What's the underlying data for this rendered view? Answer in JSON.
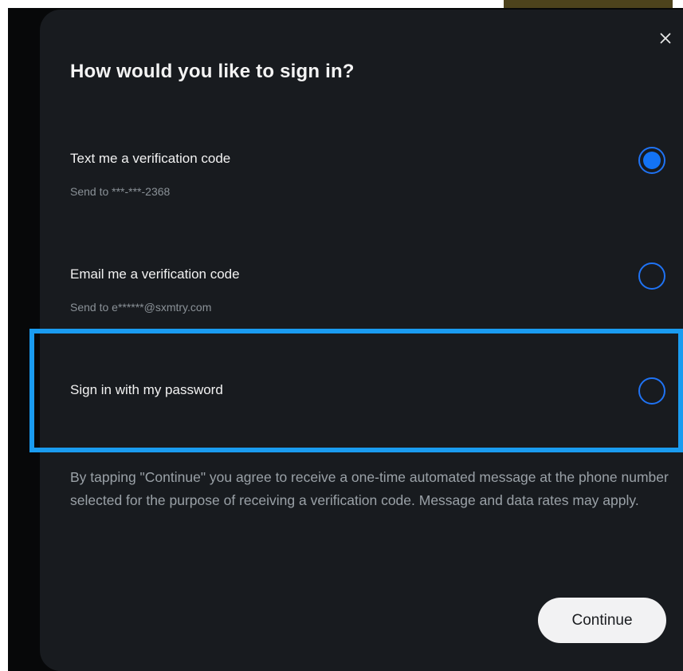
{
  "dialog": {
    "title": "How would you like to sign in?",
    "close_icon": "close-icon"
  },
  "options": [
    {
      "label": "Text me a verification code",
      "subtext": "Send to ***-***-2368",
      "selected": true
    },
    {
      "label": "Email me a verification code",
      "subtext": "Send to e******@sxmtry.com",
      "selected": false
    },
    {
      "label": "Sign in with my password",
      "selected": false
    }
  ],
  "disclaimer": "By tapping \"Continue\" you agree to receive a one-time automated message at the phone number selected for the purpose of receiving a verification code. Message and data rates may apply.",
  "actions": {
    "continue_label": "Continue"
  },
  "colors": {
    "modal_background": "#181b1f",
    "accent": "#1373f4",
    "highlight": "#1a9cf0"
  }
}
